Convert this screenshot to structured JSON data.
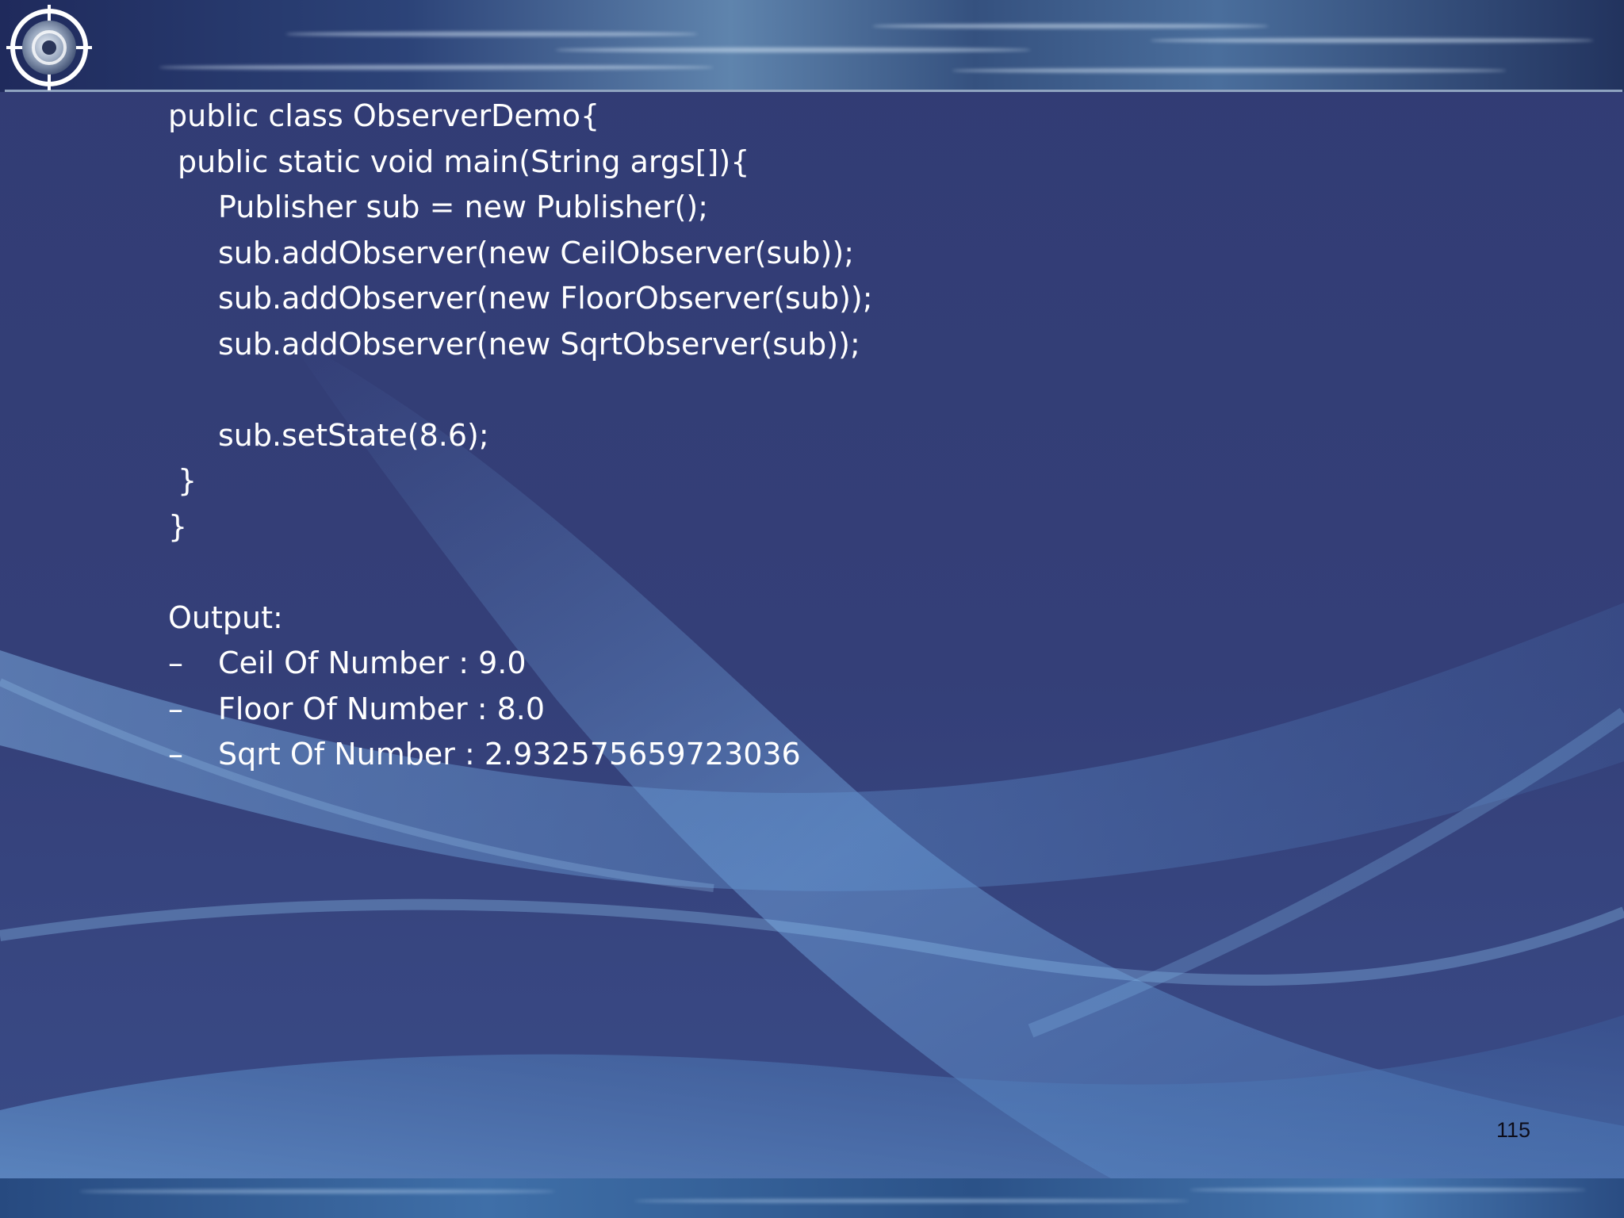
{
  "code": {
    "lines": [
      "public class ObserverDemo{",
      "public static void main(String args[]){",
      "Publisher sub = new Publisher();",
      "sub.addObserver(new CeilObserver(sub));",
      "sub.addObserver(new FloorObserver(sub));",
      "sub.addObserver(new SqrtObserver(sub));",
      "",
      "sub.setState(8.6);",
      "}",
      "}"
    ]
  },
  "output": {
    "heading": "Output:",
    "bullet": "–",
    "items": [
      "Ceil Of Number : 9.0",
      "Floor Of Number : 8.0",
      "Sqrt Of Number : 2.932575659723036"
    ]
  },
  "page_number": "115",
  "colors": {
    "background": "#343f78",
    "text": "#ffffff",
    "page_number": "#0d0d1a"
  },
  "logo": {
    "icon": "crosshair-target-icon"
  }
}
